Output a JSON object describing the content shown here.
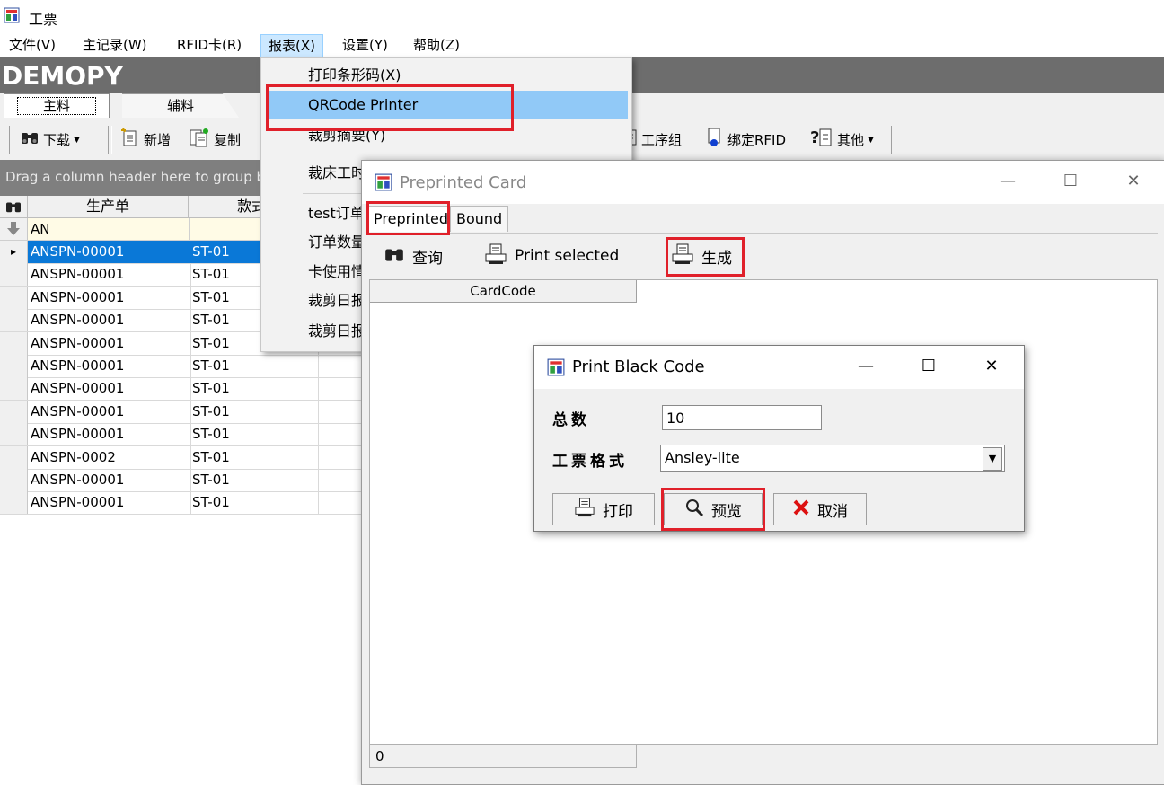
{
  "app": {
    "title": "工票"
  },
  "menubar": {
    "items": [
      "文件(V)",
      "主记录(W)",
      "RFID卡(R)",
      "报表(X)",
      "设置(Y)",
      "帮助(Z)"
    ]
  },
  "brand": "DEMOPY",
  "main_tabs": [
    "主料",
    "辅料"
  ],
  "toolbar": {
    "download": "下载",
    "add": "新增",
    "copy": "复制",
    "process_group": "工序组",
    "bind_rfid": "绑定RFID",
    "other": "其他"
  },
  "group_panel": {
    "hint": "Drag a column header here to group by"
  },
  "grid": {
    "columns": [
      "生产单",
      "款式"
    ],
    "filter_value": "AN",
    "rows": [
      [
        "ANSPN-00001",
        "ST-01"
      ],
      [
        "ANSPN-00001",
        "ST-01"
      ],
      [
        "ANSPN-00001",
        "ST-01"
      ],
      [
        "ANSPN-00001",
        "ST-01"
      ],
      [
        "ANSPN-00001",
        "ST-01"
      ],
      [
        "ANSPN-00001",
        "ST-01"
      ],
      [
        "ANSPN-00001",
        "ST-01"
      ],
      [
        "ANSPN-00001",
        "ST-01"
      ],
      [
        "ANSPN-00001",
        "ST-01"
      ],
      [
        "ANSPN-0002",
        "ST-01"
      ],
      [
        "ANSPN-00001",
        "ST-01"
      ],
      [
        "ANSPN-00001",
        "ST-01"
      ]
    ]
  },
  "report_menu": {
    "items": [
      "打印条形码(X)",
      "QRCode Printer",
      "裁剪摘要(Y)",
      "裁床工时",
      "test订单",
      "订单数量",
      "卡使用情",
      "裁剪日报",
      "裁剪日报"
    ]
  },
  "preprinted_window": {
    "title": "Preprinted Card",
    "tabs": [
      "Preprinted",
      "Bound"
    ],
    "toolbar": {
      "query": "查询",
      "print_selected": "Print selected",
      "generate": "生成"
    },
    "column": "CardCode",
    "status_count": "0"
  },
  "print_dialog": {
    "title": "Print Black Code",
    "total_label": "总数",
    "total_value": "10",
    "format_label": "工票格式",
    "format_value": "Ansley-lite",
    "print_button": "打印",
    "preview_button": "预览",
    "cancel_button": "取消"
  },
  "colors": {
    "highlight_red": "#e0202a",
    "selection_blue": "#0a78d7",
    "menu_highlight": "#91c9f7"
  }
}
